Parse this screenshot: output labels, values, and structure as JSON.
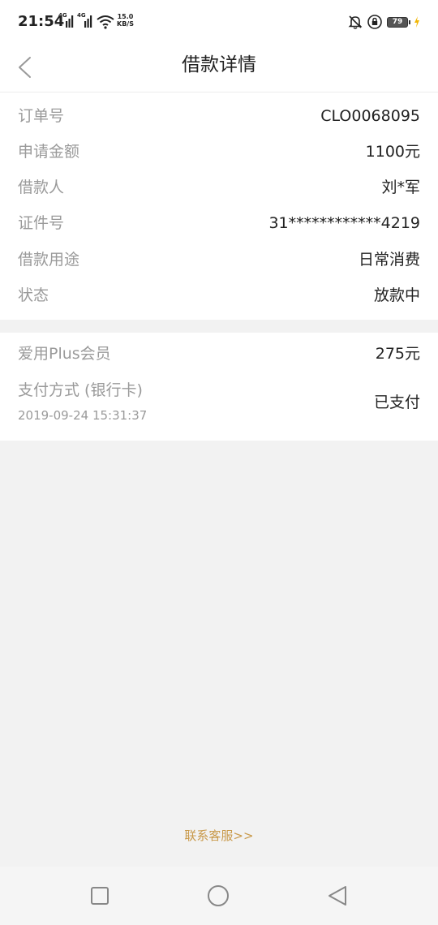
{
  "status_bar": {
    "time": "21:54",
    "signal_1_label": "4G",
    "signal_2_label": "4G",
    "speed_value": "15.0",
    "speed_unit": "KB/S",
    "battery_level": "79",
    "icons": [
      "signal-icon",
      "wifi-icon",
      "bell-off-icon",
      "lock-icon",
      "battery-icon",
      "charging-icon"
    ]
  },
  "header": {
    "title": "借款详情",
    "back_icon": "chevron-left-icon"
  },
  "loan_details": [
    {
      "label": "订单号",
      "value": "CLO0068095"
    },
    {
      "label": "申请金额",
      "value": "1100元"
    },
    {
      "label": "借款人",
      "value": "刘*军"
    },
    {
      "label": "证件号",
      "value": "31************4219"
    },
    {
      "label": "借款用途",
      "value": "日常消费"
    },
    {
      "label": "状态",
      "value": "放款中"
    }
  ],
  "membership": {
    "label": "爱用Plus会员",
    "value": "275元"
  },
  "payment": {
    "label": "支付方式 (银行卡)",
    "date": "2019-09-24 15:31:37",
    "status": "已支付"
  },
  "footer": {
    "contact_label": "联系客服>>"
  },
  "colors": {
    "accent": "#c99a4b",
    "label_gray": "#9a9a9a",
    "background": "#f2f2f2"
  }
}
